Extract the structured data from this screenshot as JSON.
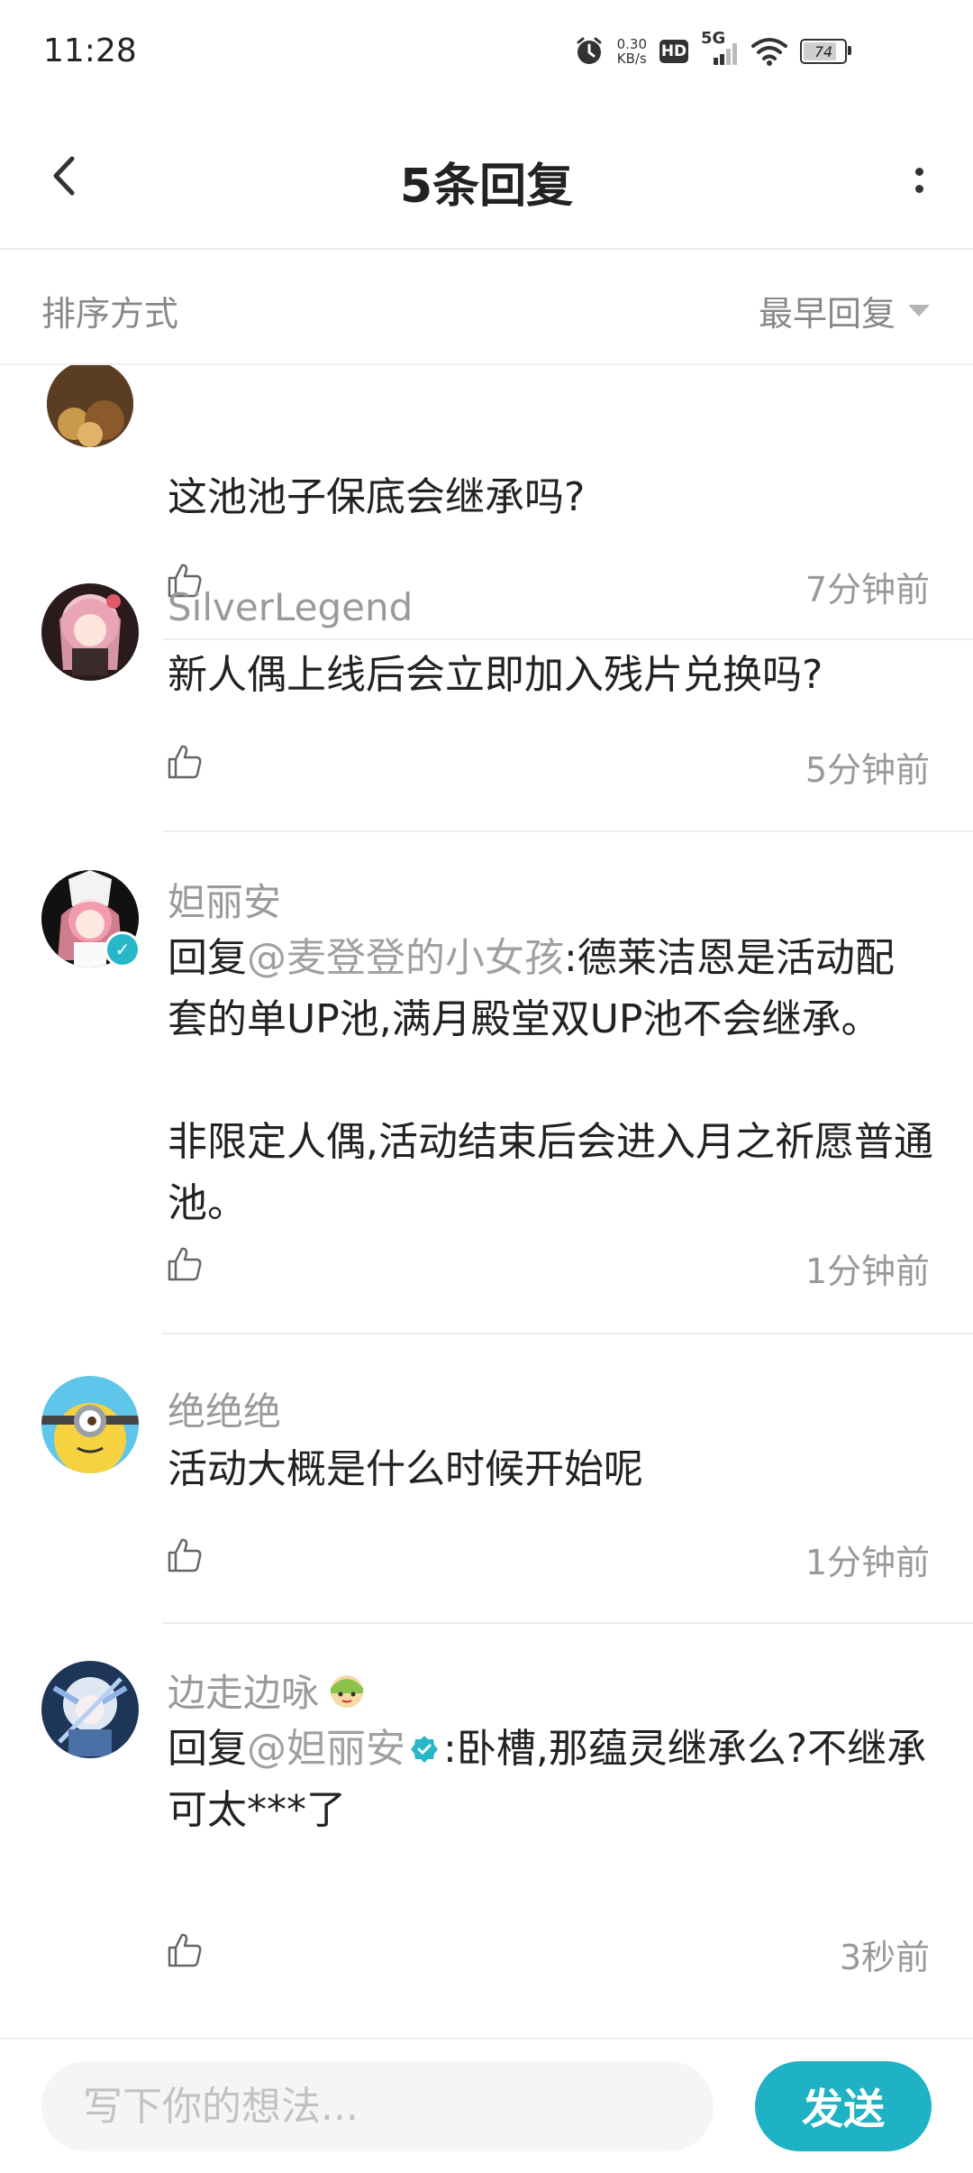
{
  "status_bar": {
    "time": "11:28",
    "speed": "0.30",
    "speed_unit": "KB/s",
    "hd": "HD",
    "network": "5G",
    "battery": "74"
  },
  "header": {
    "title": "5条回复"
  },
  "sort": {
    "label": "排序方式",
    "value": "最早回复"
  },
  "replies": [
    {
      "username": "",
      "text": "这池池子保底会继承吗?",
      "time": "7分钟前"
    },
    {
      "username": "SilverLegend",
      "text": "新人偶上线后会立即加入残片兑换吗?",
      "time": "5分钟前"
    },
    {
      "username": "妲丽安",
      "reply_prefix": "回复",
      "mention": "@麦登登的小女孩",
      "text_line1": ":德莱洁恩是活动配套的单UP池,满月殿堂双UP池不会继承。",
      "text_para2": "非限定人偶,活动结束后会进入月之祈愿普通池。",
      "time": "1分钟前"
    },
    {
      "username": "绝绝绝",
      "text": "活动大概是什么时候开始呢",
      "time": "1分钟前"
    },
    {
      "username": "边走边咏",
      "reply_prefix": "回复",
      "mention": "@妲丽安",
      "text": ":卧槽,那蕴灵继承么?不继承可太***了",
      "time": "3秒前"
    }
  ],
  "input": {
    "placeholder": "写下你的想法..."
  },
  "send": {
    "label": "发送"
  },
  "colors": {
    "accent": "#1fb2c4",
    "verified": "#26b7c9",
    "muted_text": "#999999"
  }
}
